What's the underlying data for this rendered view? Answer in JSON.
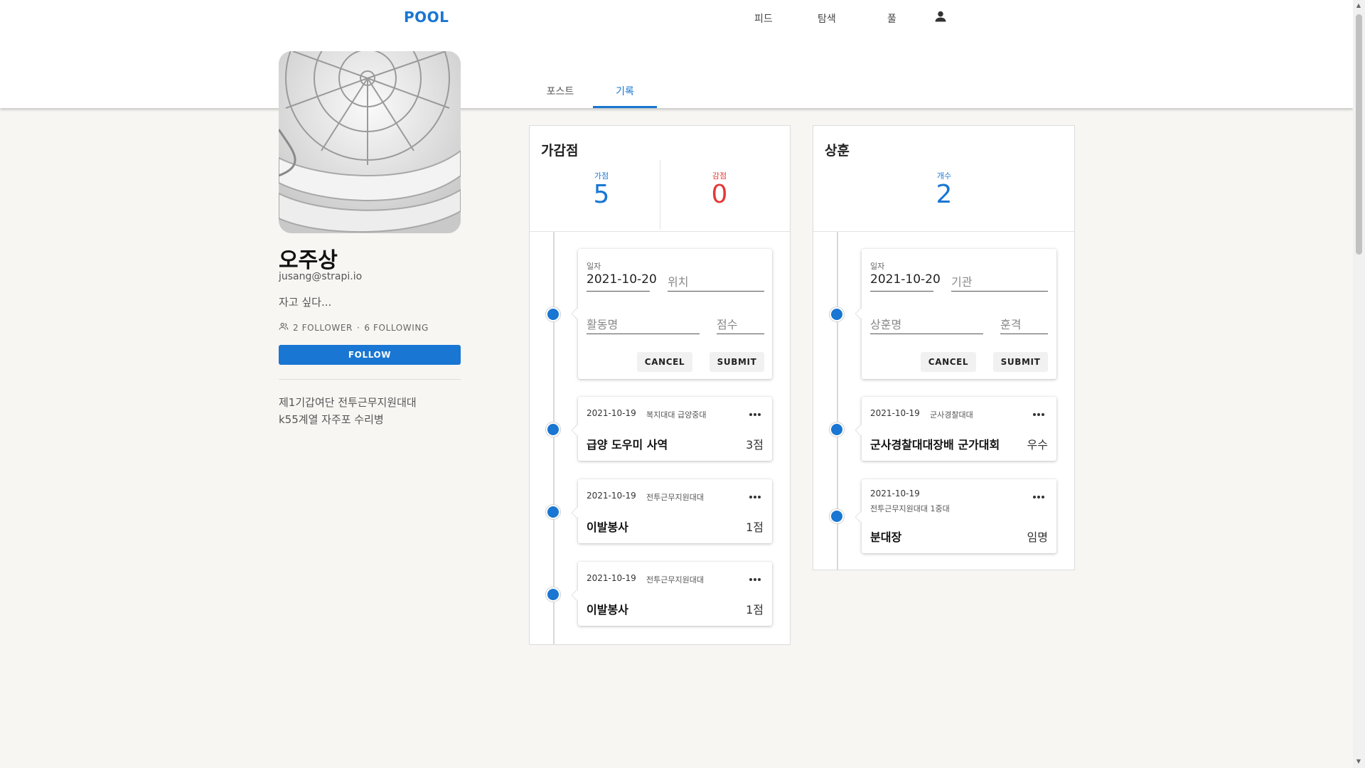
{
  "header": {
    "logo": "POOL",
    "nav": {
      "feed": "피드",
      "explore": "탐색",
      "pool": "풀"
    }
  },
  "tabs": {
    "posts": "포스트",
    "records": "기록",
    "active": "기록"
  },
  "profile": {
    "name": "오주상",
    "email": "jusang@strapi.io",
    "bio": "자고 싶다...",
    "follower_text": "2 FOLLOWER",
    "separator": "·",
    "following_text": "6 FOLLOWING",
    "follow_button": "FOLLOW",
    "description_lines": [
      "제1기갑여단 전투근무지원대대",
      "k55계열 자주포 수리병"
    ]
  },
  "points_panel": {
    "title": "가감점",
    "plus_label": "가점",
    "plus_value": "5",
    "minus_label": "감점",
    "minus_value": "0",
    "form": {
      "date_label": "일자",
      "date_value": "2021-10-20",
      "location_placeholder": "위치",
      "activity_placeholder": "활동명",
      "score_placeholder": "점수",
      "cancel": "CANCEL",
      "submit": "SUBMIT"
    },
    "entries": [
      {
        "date": "2021-10-19",
        "org": "복지대대 급양중대",
        "title": "급양 도우미 사역",
        "score": "3점"
      },
      {
        "date": "2021-10-19",
        "org": "전투근무지원대대",
        "title": "이발봉사",
        "score": "1점"
      },
      {
        "date": "2021-10-19",
        "org": "전투근무지원대대",
        "title": "이발봉사",
        "score": "1점"
      }
    ]
  },
  "awards_panel": {
    "title": "상훈",
    "count_label": "개수",
    "count_value": "2",
    "form": {
      "date_label": "일자",
      "date_value": "2021-10-20",
      "agency_placeholder": "기관",
      "award_placeholder": "상훈명",
      "grade_placeholder": "훈격",
      "cancel": "CANCEL",
      "submit": "SUBMIT"
    },
    "entries": [
      {
        "date": "2021-10-19",
        "org": "군사경찰대대",
        "title": "군사경찰대대장배 군가대회",
        "grade": "우수"
      },
      {
        "date": "2021-10-19",
        "org": "전투근무지원대대 1중대",
        "title": "분대장",
        "grade": "임명"
      }
    ]
  },
  "colors": {
    "accent": "#1976d2",
    "minus": "#e53935",
    "background": "#f7f6f3"
  },
  "icons": {
    "user": "person-icon",
    "people": "people-icon",
    "more": "more-horizontal-icon"
  }
}
